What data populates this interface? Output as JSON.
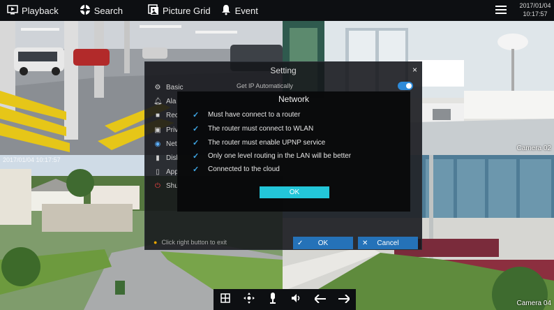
{
  "topbar": {
    "playback_label": "Playback",
    "search_label": "Search",
    "picture_grid_label": "Picture Grid",
    "event_label": "Event",
    "date": "2017/01/04",
    "time": "10:17:57"
  },
  "cameras": {
    "top_right_label": "Camera 02",
    "bottom_left_timestamp": "2017/01/04 10:17:57",
    "bottom_right_label": "Camera 04"
  },
  "setting_dialog": {
    "title": "Setting",
    "close_icon": "×",
    "get_ip_label": "Get IP Automatically",
    "get_ip_enabled": true,
    "menu": [
      {
        "label": "Basic",
        "icon": "gear-icon"
      },
      {
        "label": "Ala",
        "icon": "bell-icon"
      },
      {
        "label": "Rec",
        "icon": "video-icon"
      },
      {
        "label": "Priv",
        "icon": "image-icon"
      },
      {
        "label": "Net",
        "icon": "globe-icon",
        "active": true
      },
      {
        "label": "Disk",
        "icon": "disk-icon"
      },
      {
        "label": "App",
        "icon": "phone-icon"
      },
      {
        "label": "Shu",
        "icon": "power-icon"
      }
    ],
    "hint": "Click right button to exit",
    "ok_label": "OK",
    "cancel_label": "Cancel"
  },
  "network_popup": {
    "title": "Network",
    "items": [
      "Must have connect to a router",
      "The router must connect to WLAN",
      "The router must enable UPNP service",
      "Only one level routing in the LAN will be better",
      "Connected to the cloud"
    ],
    "ok_label": "OK"
  },
  "bottombar": {
    "icons": [
      "grid-icon",
      "ptz-icon",
      "microphone-icon",
      "speaker-icon",
      "arrow-left-icon",
      "arrow-right-icon"
    ]
  },
  "colors": {
    "accent": "#2572b8",
    "check": "#3fa7e6",
    "ok_button": "#23c6d9"
  }
}
